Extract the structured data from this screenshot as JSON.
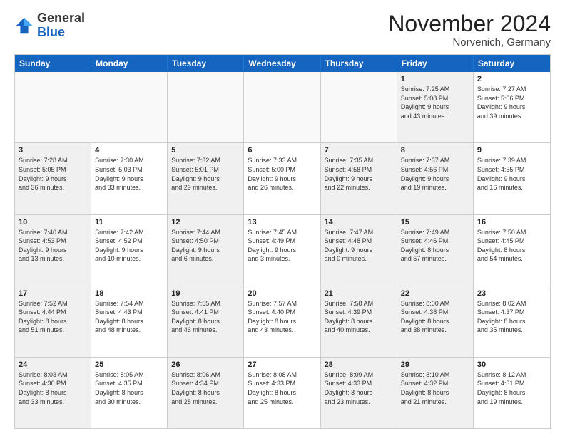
{
  "logo": {
    "general": "General",
    "blue": "Blue"
  },
  "title": "November 2024",
  "subtitle": "Norvenich, Germany",
  "header_days": [
    "Sunday",
    "Monday",
    "Tuesday",
    "Wednesday",
    "Thursday",
    "Friday",
    "Saturday"
  ],
  "weeks": [
    [
      {
        "day": "",
        "text": "",
        "shaded": false,
        "empty": true
      },
      {
        "day": "",
        "text": "",
        "shaded": false,
        "empty": true
      },
      {
        "day": "",
        "text": "",
        "shaded": false,
        "empty": true
      },
      {
        "day": "",
        "text": "",
        "shaded": false,
        "empty": true
      },
      {
        "day": "",
        "text": "",
        "shaded": false,
        "empty": true
      },
      {
        "day": "1",
        "text": "Sunrise: 7:25 AM\nSunset: 5:08 PM\nDaylight: 9 hours\nand 43 minutes.",
        "shaded": true,
        "empty": false
      },
      {
        "day": "2",
        "text": "Sunrise: 7:27 AM\nSunset: 5:06 PM\nDaylight: 9 hours\nand 39 minutes.",
        "shaded": false,
        "empty": false
      }
    ],
    [
      {
        "day": "3",
        "text": "Sunrise: 7:28 AM\nSunset: 5:05 PM\nDaylight: 9 hours\nand 36 minutes.",
        "shaded": true,
        "empty": false
      },
      {
        "day": "4",
        "text": "Sunrise: 7:30 AM\nSunset: 5:03 PM\nDaylight: 9 hours\nand 33 minutes.",
        "shaded": false,
        "empty": false
      },
      {
        "day": "5",
        "text": "Sunrise: 7:32 AM\nSunset: 5:01 PM\nDaylight: 9 hours\nand 29 minutes.",
        "shaded": true,
        "empty": false
      },
      {
        "day": "6",
        "text": "Sunrise: 7:33 AM\nSunset: 5:00 PM\nDaylight: 9 hours\nand 26 minutes.",
        "shaded": false,
        "empty": false
      },
      {
        "day": "7",
        "text": "Sunrise: 7:35 AM\nSunset: 4:58 PM\nDaylight: 9 hours\nand 22 minutes.",
        "shaded": true,
        "empty": false
      },
      {
        "day": "8",
        "text": "Sunrise: 7:37 AM\nSunset: 4:56 PM\nDaylight: 9 hours\nand 19 minutes.",
        "shaded": true,
        "empty": false
      },
      {
        "day": "9",
        "text": "Sunrise: 7:39 AM\nSunset: 4:55 PM\nDaylight: 9 hours\nand 16 minutes.",
        "shaded": false,
        "empty": false
      }
    ],
    [
      {
        "day": "10",
        "text": "Sunrise: 7:40 AM\nSunset: 4:53 PM\nDaylight: 9 hours\nand 13 minutes.",
        "shaded": true,
        "empty": false
      },
      {
        "day": "11",
        "text": "Sunrise: 7:42 AM\nSunset: 4:52 PM\nDaylight: 9 hours\nand 10 minutes.",
        "shaded": false,
        "empty": false
      },
      {
        "day": "12",
        "text": "Sunrise: 7:44 AM\nSunset: 4:50 PM\nDaylight: 9 hours\nand 6 minutes.",
        "shaded": true,
        "empty": false
      },
      {
        "day": "13",
        "text": "Sunrise: 7:45 AM\nSunset: 4:49 PM\nDaylight: 9 hours\nand 3 minutes.",
        "shaded": false,
        "empty": false
      },
      {
        "day": "14",
        "text": "Sunrise: 7:47 AM\nSunset: 4:48 PM\nDaylight: 9 hours\nand 0 minutes.",
        "shaded": true,
        "empty": false
      },
      {
        "day": "15",
        "text": "Sunrise: 7:49 AM\nSunset: 4:46 PM\nDaylight: 8 hours\nand 57 minutes.",
        "shaded": true,
        "empty": false
      },
      {
        "day": "16",
        "text": "Sunrise: 7:50 AM\nSunset: 4:45 PM\nDaylight: 8 hours\nand 54 minutes.",
        "shaded": false,
        "empty": false
      }
    ],
    [
      {
        "day": "17",
        "text": "Sunrise: 7:52 AM\nSunset: 4:44 PM\nDaylight: 8 hours\nand 51 minutes.",
        "shaded": true,
        "empty": false
      },
      {
        "day": "18",
        "text": "Sunrise: 7:54 AM\nSunset: 4:43 PM\nDaylight: 8 hours\nand 48 minutes.",
        "shaded": false,
        "empty": false
      },
      {
        "day": "19",
        "text": "Sunrise: 7:55 AM\nSunset: 4:41 PM\nDaylight: 8 hours\nand 46 minutes.",
        "shaded": true,
        "empty": false
      },
      {
        "day": "20",
        "text": "Sunrise: 7:57 AM\nSunset: 4:40 PM\nDaylight: 8 hours\nand 43 minutes.",
        "shaded": false,
        "empty": false
      },
      {
        "day": "21",
        "text": "Sunrise: 7:58 AM\nSunset: 4:39 PM\nDaylight: 8 hours\nand 40 minutes.",
        "shaded": true,
        "empty": false
      },
      {
        "day": "22",
        "text": "Sunrise: 8:00 AM\nSunset: 4:38 PM\nDaylight: 8 hours\nand 38 minutes.",
        "shaded": true,
        "empty": false
      },
      {
        "day": "23",
        "text": "Sunrise: 8:02 AM\nSunset: 4:37 PM\nDaylight: 8 hours\nand 35 minutes.",
        "shaded": false,
        "empty": false
      }
    ],
    [
      {
        "day": "24",
        "text": "Sunrise: 8:03 AM\nSunset: 4:36 PM\nDaylight: 8 hours\nand 33 minutes.",
        "shaded": true,
        "empty": false
      },
      {
        "day": "25",
        "text": "Sunrise: 8:05 AM\nSunset: 4:35 PM\nDaylight: 8 hours\nand 30 minutes.",
        "shaded": false,
        "empty": false
      },
      {
        "day": "26",
        "text": "Sunrise: 8:06 AM\nSunset: 4:34 PM\nDaylight: 8 hours\nand 28 minutes.",
        "shaded": true,
        "empty": false
      },
      {
        "day": "27",
        "text": "Sunrise: 8:08 AM\nSunset: 4:33 PM\nDaylight: 8 hours\nand 25 minutes.",
        "shaded": false,
        "empty": false
      },
      {
        "day": "28",
        "text": "Sunrise: 8:09 AM\nSunset: 4:33 PM\nDaylight: 8 hours\nand 23 minutes.",
        "shaded": true,
        "empty": false
      },
      {
        "day": "29",
        "text": "Sunrise: 8:10 AM\nSunset: 4:32 PM\nDaylight: 8 hours\nand 21 minutes.",
        "shaded": true,
        "empty": false
      },
      {
        "day": "30",
        "text": "Sunrise: 8:12 AM\nSunset: 4:31 PM\nDaylight: 8 hours\nand 19 minutes.",
        "shaded": false,
        "empty": false
      }
    ]
  ]
}
